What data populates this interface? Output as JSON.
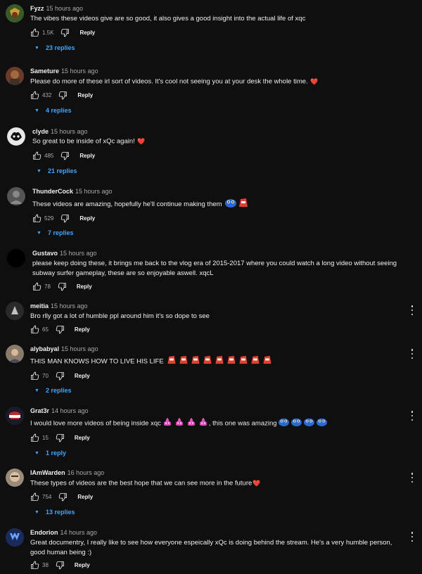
{
  "comments": [
    {
      "author": "Fyzz",
      "time": "15 hours ago",
      "text": "The vibes these videos give are so good, it also gives a good insight into the actual life of xqc",
      "likes": "1.5K",
      "reply_label": "Reply",
      "replies": "23 replies",
      "avatar_color": "#3b5a2a",
      "show_menu": false
    },
    {
      "author": "Sameture",
      "time": "15 hours ago",
      "text": "Please do more of these irl sort of videos. It's cool not seeing you at your desk the whole time.",
      "emoji_after": "❤️",
      "likes": "432",
      "reply_label": "Reply",
      "replies": "4 replies",
      "avatar_color": "#6b3b2a",
      "show_menu": false
    },
    {
      "author": "clyde",
      "time": "15 hours ago",
      "text": "So great to be inside of xQc again!",
      "emoji_after": "❤️",
      "likes": "485",
      "reply_label": "Reply",
      "replies": "21 replies",
      "avatar_color": "#d9d9d9",
      "show_menu": false
    },
    {
      "author": "ThunderCock",
      "time": "15 hours ago",
      "text": "These videos are amazing, hopefully he'll continue making them",
      "likes": "529",
      "reply_label": "Reply",
      "replies": "7 replies",
      "avatar_color": "#555555",
      "show_menu": false
    },
    {
      "author": "Gustavo",
      "time": "15 hours ago",
      "text": "please keep doing these, it brings me back to the vlog era of 2015-2017 where you could watch a long video without seeing subway surfer gameplay, these are so enjoyable aswell. xqcL",
      "likes": "78",
      "reply_label": "Reply",
      "avatar_color": "#000000",
      "show_menu": false
    },
    {
      "author": "meitia",
      "time": "15 hours ago",
      "text": "Bro rlly got a lot of humble ppl around him it’s so dope to see",
      "likes": "65",
      "reply_label": "Reply",
      "avatar_color": "#2a2a2a",
      "show_menu": true
    },
    {
      "author": "alybabyal",
      "time": "15 hours ago",
      "text": "THIS MAN KNOWS HOW TO LIVE HIS LIFE",
      "likes": "70",
      "reply_label": "Reply",
      "replies": "2 replies",
      "avatar_color": "#8a7a6a",
      "show_menu": true
    },
    {
      "author": "Grat3r",
      "time": "14 hours ago",
      "text": "I would love more videos of being inside xqc",
      "text2": ", this one was amazing",
      "likes": "15",
      "reply_label": "Reply",
      "replies": "1 reply",
      "avatar_color": "#1a1a2a",
      "show_menu": true
    },
    {
      "author": "IAmWarden",
      "time": "16 hours ago",
      "text": "These types of videos are the best hope that we can see more in the future",
      "emoji_after": "❤️",
      "likes": "754",
      "reply_label": "Reply",
      "replies": "13 replies",
      "avatar_color": "#9a8a7a",
      "show_menu": true
    },
    {
      "author": "Endorion",
      "time": "14 hours ago",
      "text": "Great documentry, I really like to see how everyone espeically xQc is doing behind the stream. He's a very humble person, good human being :)",
      "likes": "38",
      "reply_label": "Reply",
      "avatar_color": "#1a2a5a",
      "show_menu": true
    }
  ]
}
